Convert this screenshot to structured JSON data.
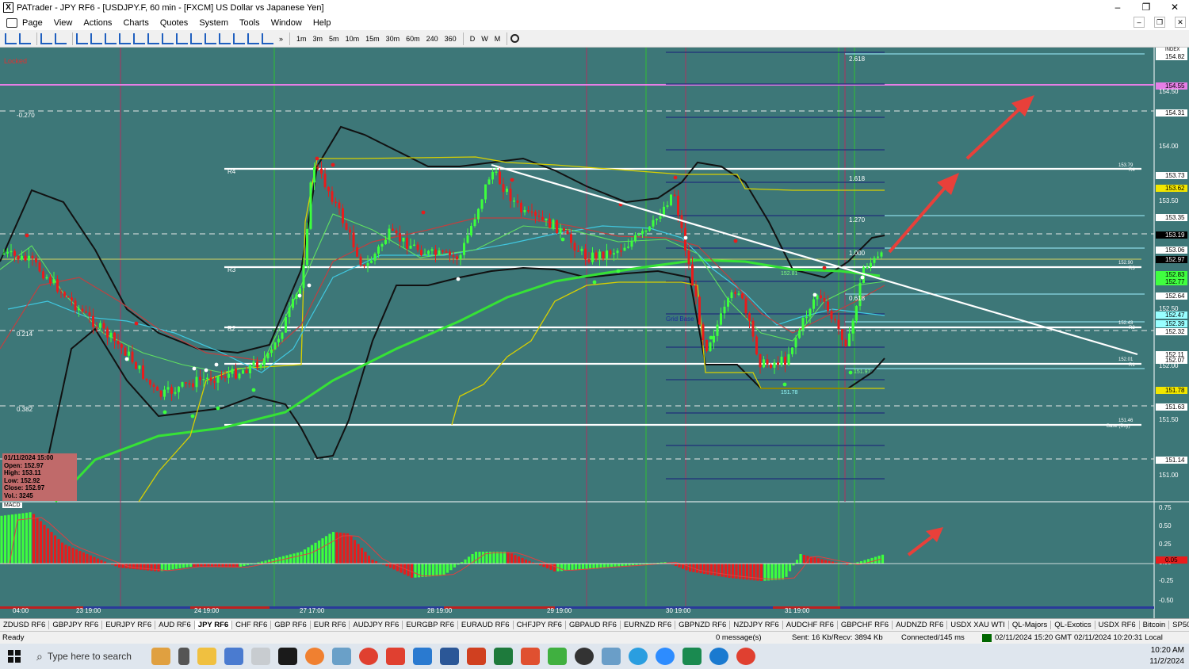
{
  "window": {
    "title": "PATrader - JPY RF6 - [USDJPY.F, 60 min - [FXCM] US Dollar vs Japanese Yen]",
    "minimize_glyph": "–",
    "maximize_glyph": "❐",
    "close_glyph": "✕"
  },
  "menu": [
    "Page",
    "View",
    "Actions",
    "Charts",
    "Quotes",
    "System",
    "Tools",
    "Window",
    "Help"
  ],
  "toolbar": {
    "timeframes": [
      "1m",
      "3m",
      "5m",
      "10m",
      "15m",
      "30m",
      "60m",
      "240",
      "360"
    ],
    "periods": [
      "D",
      "W",
      "M"
    ],
    "more_glyph": "»"
  },
  "chart": {
    "locked_label": "Locked",
    "symbol": "USDJPY.F",
    "fib_left": [
      "-0.270",
      "0.214",
      "0.382"
    ],
    "fib_right": [
      "2.618",
      "1.618",
      "1.270",
      "1.000",
      "0.618"
    ],
    "pivot_labels": [
      "R4",
      "R3",
      "R2"
    ],
    "grid_label": "Grid Base",
    "base_label": "Base (Buy)",
    "right_small": [
      "153.79",
      "152.90",
      "152.43",
      "152.01",
      "151.46"
    ],
    "right_suffix": [
      "R4",
      "R3",
      "R2",
      "R1"
    ],
    "low_tags": [
      "151.97",
      "151.78",
      "152.81"
    ],
    "index_label": "INDEX",
    "price_axis": [
      "154.82",
      "154.55",
      "154.50",
      "154.31",
      "154.00",
      "153.73",
      "153.62",
      "153.50",
      "153.35",
      "153.19",
      "153.06",
      "152.97",
      "152.83",
      "152.77",
      "152.64",
      "152.50",
      "152.47",
      "152.39",
      "152.32",
      "152.11",
      "152.07",
      "152.00",
      "151.78",
      "151.63",
      "151.50",
      "151.14",
      "151.00"
    ],
    "date_axis": [
      "04:00",
      "23 19:00",
      "24 19:00",
      "27 17:00",
      "28 19:00",
      "29 19:00",
      "30 19:00",
      "31 19:00"
    ],
    "ohlc": {
      "date": "01/11/2024 15:00",
      "open": "Open: 152.97",
      "high": "High: 153.11",
      "low": "Low: 152.92",
      "close": "Close: 152.97",
      "vol": "Vol.: 3245"
    },
    "macd_label": "MACD",
    "macd_axis": [
      "0.75",
      "0.50",
      "0.25",
      "0.00",
      "-0.25",
      "-0.50"
    ],
    "macd_tag": "0.05"
  },
  "tabs": [
    "ZDUSD RF6",
    "GBPJPY RF6",
    "EURJPY RF6",
    "AUD RF6",
    "JPY RF6",
    "CHF RF6",
    "GBP RF6",
    "EUR RF6",
    "AUDJPY RF6",
    "EURGBP RF6",
    "EURAUD RF6",
    "CHFJPY RF6",
    "GBPAUD RF6",
    "EURNZD RF6",
    "GBPNZD RF6",
    "NZDJPY RF6",
    "AUDCHF RF6",
    "GBPCHF RF6",
    "AUDNZD RF6",
    "USDX XAU WTI",
    "QL-Majors",
    "QL-Exotics",
    "USDX RF6",
    "Bitcoin",
    "SP500 RF6",
    "DJIA",
    "Lyte"
  ],
  "active_tab": "JPY RF6",
  "status": {
    "ready": "Ready",
    "messages": "0 message(s)",
    "traffic": "Sent: 16 Kb/Recv: 3894 Kb",
    "connection": "Connected/145 ms",
    "gmt": "02/11/2024 15:20 GMT",
    "local": "02/11/2024 10:20:31 Local"
  },
  "taskbar": {
    "search_placeholder": "Type here to search",
    "time": "10:20 AM",
    "date": "11/2/2024"
  },
  "colors": {
    "chart_bg": "#3d7778",
    "bull": "#3dff3d",
    "bear": "#e81c1c",
    "arrow": "#e8403a",
    "trendline": "#ffffff",
    "ma_green": "#36e236"
  }
}
